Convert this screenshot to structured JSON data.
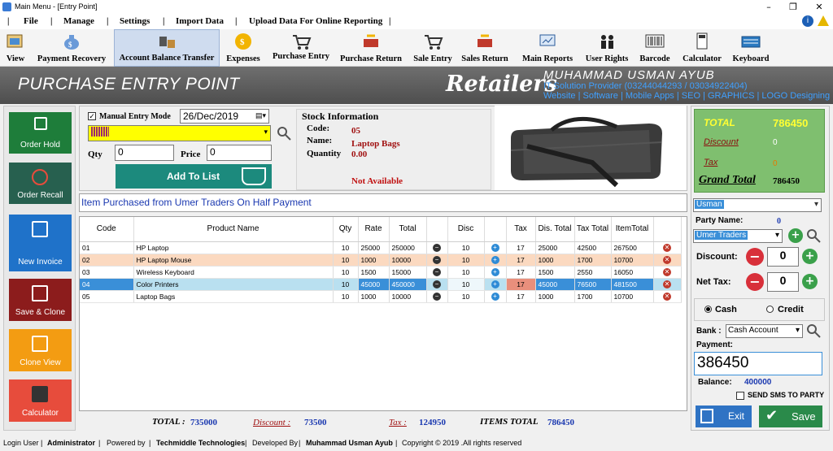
{
  "window": {
    "title": "Main Menu - [Entry Point]",
    "min": "–",
    "max": "❐",
    "close": "✕"
  },
  "menu": [
    "File",
    "Manage",
    "Settings",
    "Import Data",
    "Upload Data For Online Reporting"
  ],
  "menu_seps": [
    "|",
    "|",
    "|",
    "|",
    "|",
    "|"
  ],
  "toolbar": [
    "View",
    "Payment Recovery",
    "Account Balance Transfer",
    "Expenses",
    "Purchase Entry",
    "Purchase Return",
    "Sale Entry",
    "Sales Return",
    "Main Reports",
    "User Rights",
    "Barcode",
    "Calculator",
    "Keyboard"
  ],
  "banner": {
    "title": "PURCHASE ENTRY POINT",
    "brand": "Retailers",
    "name": "MUHAMMAD USMAN AYUB",
    "line1": "IT Solution Provider (03244044293 / 03034922404)",
    "line2": "Website | Software | Mobile Apps | SEO | GRAPHICS | LOGO Designing"
  },
  "nav": [
    "Order Hold",
    "Order Recall",
    "New Invoice",
    "Save & Clone",
    "Clone View",
    "Calculator"
  ],
  "entry": {
    "manual_label": "Manual Entry Mode",
    "date": "26/Dec/2019",
    "qty_label": "Qty",
    "qty": "0",
    "price_label": "Price",
    "price": "0",
    "add_button": "Add To List"
  },
  "stock": {
    "heading": "Stock Information",
    "code_label": "Code:",
    "code": "05",
    "name_label": "Name:",
    "name": "Laptop Bags",
    "qty_label": "Quantity",
    "qty": "0.00",
    "status": "Not Available"
  },
  "note": "Item Purchased from Umer Traders On Half Payment",
  "grid": {
    "headers": [
      "Code",
      "Product Name",
      "Qty",
      "Rate",
      "Total",
      "",
      "Disc",
      "",
      "Tax",
      "Dis. Total",
      "Tax Total",
      "ItemTotal",
      ""
    ],
    "rows": [
      [
        "01",
        "HP Laptop",
        "10",
        "25000",
        "250000",
        "10",
        "17",
        "25000",
        "42500",
        "267500"
      ],
      [
        "02",
        "HP Laptop Mouse",
        "10",
        "1000",
        "10000",
        "10",
        "17",
        "1000",
        "1700",
        "10700"
      ],
      [
        "03",
        "Wireless Keyboard",
        "10",
        "1500",
        "15000",
        "10",
        "17",
        "1500",
        "2550",
        "16050"
      ],
      [
        "04",
        "Color Printers",
        "10",
        "45000",
        "450000",
        "10",
        "17",
        "45000",
        "76500",
        "481500"
      ],
      [
        "05",
        "Laptop Bags",
        "10",
        "1000",
        "10000",
        "10",
        "17",
        "1000",
        "1700",
        "10700"
      ]
    ]
  },
  "totals": {
    "total_label": "TOTAL :",
    "total": "735000",
    "discount_label": "Discount :",
    "discount": "73500",
    "tax_label": "Tax :",
    "tax": "124950",
    "items_label": "ITEMS TOTAL",
    "items": "786450"
  },
  "right": {
    "total_label": "TOTAL",
    "total": "786450",
    "discount_label": "Discount",
    "discount": "0",
    "tax_label": "Tax",
    "tax": "0",
    "grand_label": "Grand Total",
    "grand": "786450",
    "user": "Usman",
    "party_label": "Party Name:",
    "party_id": "0",
    "party": "Umer Traders",
    "disc_label": "Discount:",
    "disc_val": "0",
    "nettax_label": "Net Tax:",
    "nettax_val": "0",
    "cash": "Cash",
    "credit": "Credit",
    "bank_label": "Bank :",
    "bank": "Cash Account",
    "payment_label": "Payment:",
    "payment": "386450",
    "balance_label": "Balance:",
    "balance": "400000",
    "sms": "SEND SMS TO PARTY",
    "exit": "Exit",
    "save": "Save"
  },
  "status": {
    "login_label": "Login User",
    "login": "Administrator",
    "powered_label": "Powered by",
    "powered": "Techmiddle Technologies",
    "dev_label": "Developed By",
    "dev": "Muhammad Usman Ayub",
    "copyright": "Copyright © 2019 .All rights reserved"
  },
  "colors": {
    "nav": [
      "#1e7d3a",
      "#27604f",
      "#1f72c9",
      "#8c1c1c",
      "#f39c12",
      "#e74c3c"
    ],
    "summary_bg": "#7fbf6f",
    "add_btn": "#1c8a7d",
    "save_btn": "#2a8a4a",
    "exit_btn": "#2f73c4",
    "selected_row": "#b9e0f0",
    "orange_row": "#fbd9c0"
  }
}
